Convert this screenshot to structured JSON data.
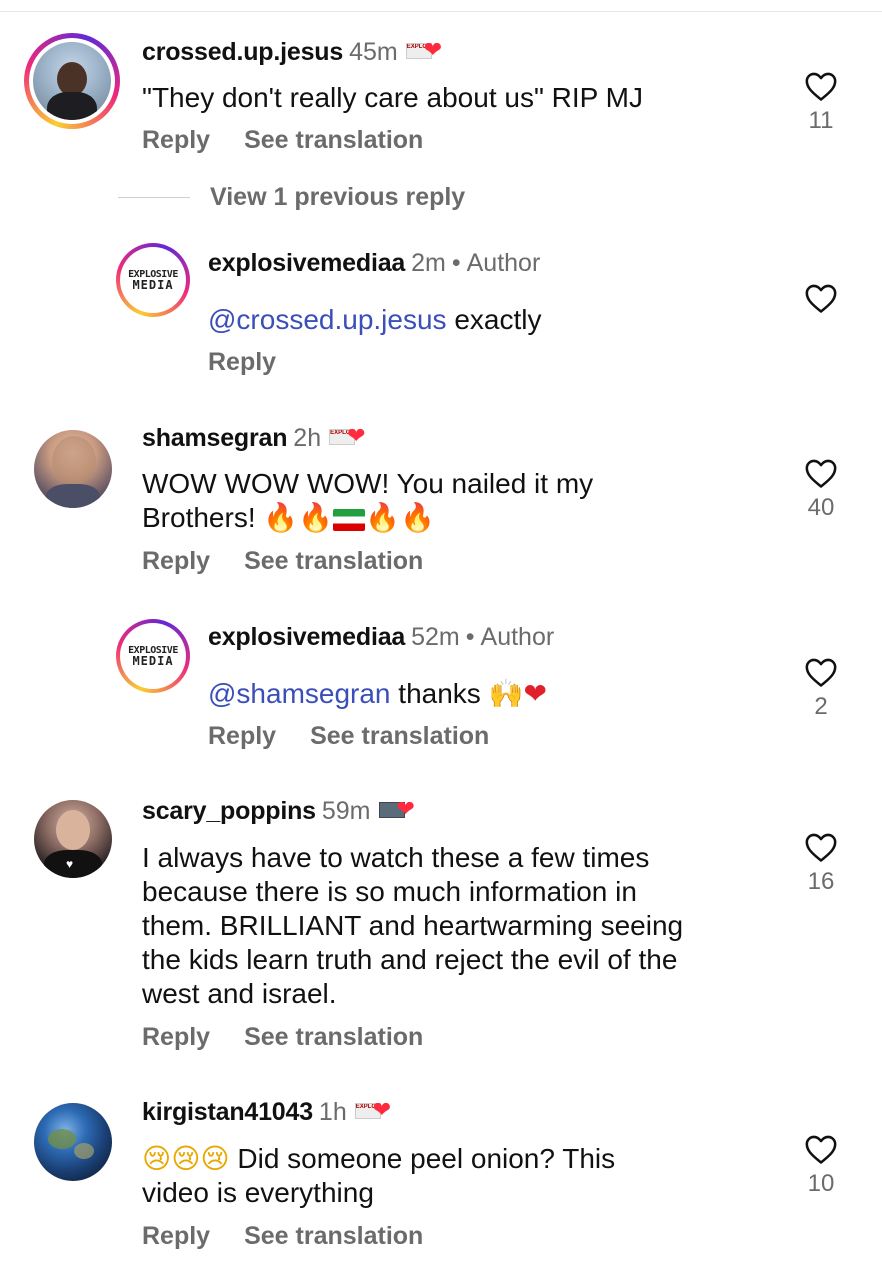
{
  "actions": {
    "reply": "Reply",
    "see_translation": "See translation"
  },
  "comments": [
    {
      "username": "crossed.up.jesus",
      "time": "45m",
      "text": "\"They don't really care about us\" RIP MJ",
      "likes": "11"
    },
    {
      "view_previous": "View 1 previous reply",
      "username": "explosivemediaa",
      "time": "2m",
      "author_label": "Author",
      "mention": "@crossed.up.jesus",
      "text": " exactly",
      "logo_line1": "EXPLOSIVE",
      "logo_line2": "MEDIA"
    },
    {
      "username": "shamsegran",
      "time": "2h",
      "text_line1": "WOW WOW WOW! You nailed it my",
      "text_line2": "Brothers!",
      "likes": "40"
    },
    {
      "username": "explosivemediaa",
      "time": "52m",
      "author_label": "Author",
      "mention": "@shamsegran",
      "text": " thanks",
      "likes": "2",
      "logo_line1": "EXPLOSIVE",
      "logo_line2": "MEDIA"
    },
    {
      "username": "scary_poppins",
      "time": "59m",
      "lines": [
        "I always have to watch these a few times",
        "because there is so much information in",
        "them. BRILLIANT and heartwarming seeing",
        "the kids learn truth and reject the evil of the",
        "west and israel."
      ],
      "likes": "16"
    },
    {
      "username": "kirgistan41043",
      "time": "1h",
      "text_line1": "Did someone peel onion? This",
      "text_line2": "video is everything",
      "likes": "10"
    }
  ],
  "badge_text": "EXPLOSIVE MEDIA",
  "icons": {
    "like": "heart-outline-icon",
    "liked_by_author": "heart-icon",
    "fire": "fire-emoji",
    "flag": "iran-flag-emoji",
    "crying": "crying-face-emoji",
    "raised_hands": "raised-hands-emoji"
  },
  "colors": {
    "mention": "#3b4fb8",
    "muted": "#6b6b6b",
    "heart": "#ff2a3d"
  }
}
